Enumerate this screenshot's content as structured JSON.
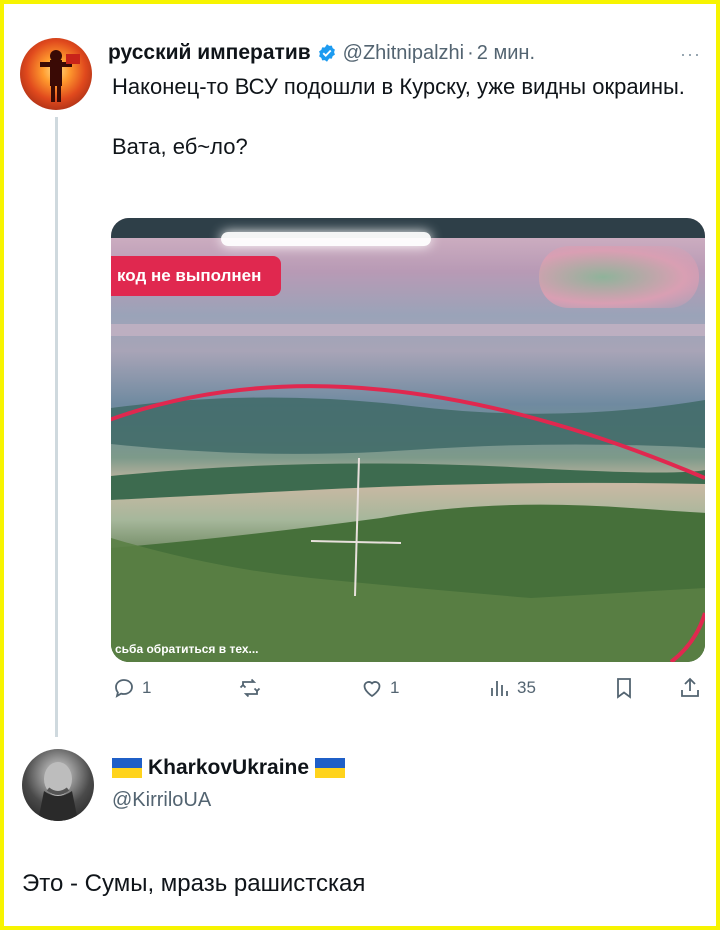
{
  "tweet": {
    "display_name": "русский императив",
    "handle": "@Zhitnipalzhi",
    "separator": "·",
    "time": "2 мин.",
    "more_label": "···",
    "text_line1": "Наконец-то ВСУ подошли в Курску, уже видны окраины.",
    "text_line2": "Вата, еб~ло?",
    "media": {
      "red_label": "код не выполнен",
      "bottom_text": "сьба обратиться в тех..."
    },
    "actions": {
      "replies": "1",
      "retweets": "",
      "likes": "1",
      "views": "35"
    }
  },
  "reply": {
    "display_name": "KharkovUkraine",
    "handle": "@KirriloUA",
    "text": "Это - Сумы, мразь рашистская"
  },
  "colors": {
    "frame": "#f7f400",
    "verified": "#1d9bf0",
    "flag_blue": "#1f5fc7",
    "flag_yellow": "#ffd31c",
    "media_label": "#e0284f"
  }
}
